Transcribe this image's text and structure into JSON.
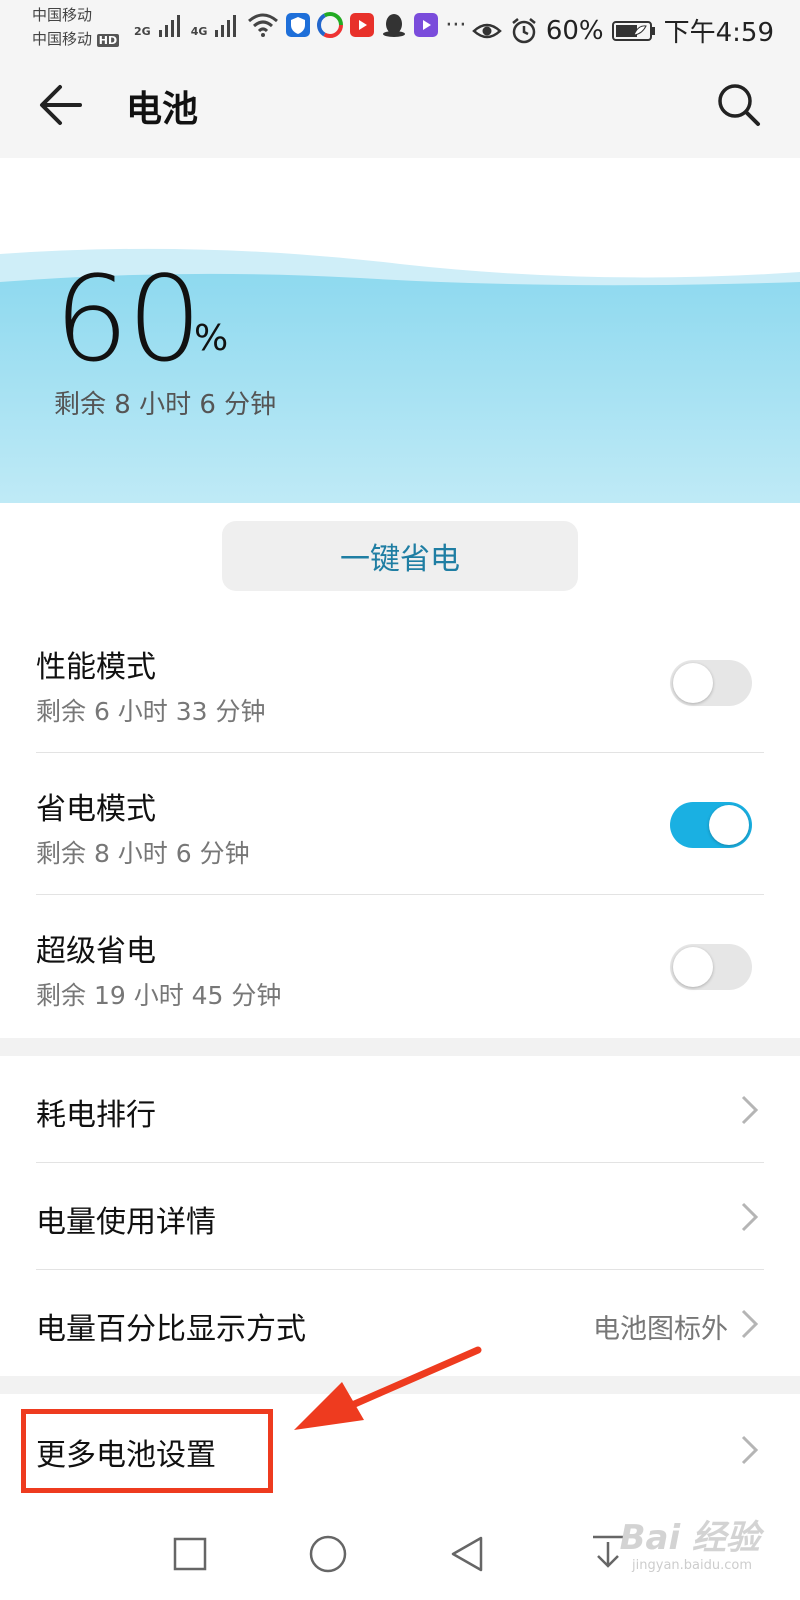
{
  "status_bar": {
    "carrier1": "中国移动",
    "carrier2": "中国移动",
    "hd_badge": "HD",
    "net1": "2G",
    "net2": "4G",
    "battery_percent": "60%",
    "time": "下午4:59",
    "more": "···"
  },
  "header": {
    "title": "电池"
  },
  "battery": {
    "percent": "60",
    "percent_sign": "%",
    "remaining": "剩余 8 小时 6 分钟"
  },
  "one_key_button": "一键省电",
  "modes": [
    {
      "title": "性能模式",
      "subtitle": "剩余 6 小时 33 分钟",
      "enabled": false
    },
    {
      "title": "省电模式",
      "subtitle": "剩余 8 小时 6 分钟",
      "enabled": true
    },
    {
      "title": "超级省电",
      "subtitle": "剩余 19 小时 45 分钟",
      "enabled": false
    }
  ],
  "menu": [
    {
      "title": "耗电排行",
      "value": ""
    },
    {
      "title": "电量使用详情",
      "value": ""
    },
    {
      "title": "电量百分比显示方式",
      "value": "电池图标外"
    }
  ],
  "more_settings": {
    "title": "更多电池设置"
  },
  "watermark": {
    "text": "Bai 经验",
    "sub": "jingyan.baidu.com"
  },
  "colors": {
    "accent": "#1ab0e2",
    "highlight": "#ee3b1f",
    "wave": "#8ed9ef"
  }
}
